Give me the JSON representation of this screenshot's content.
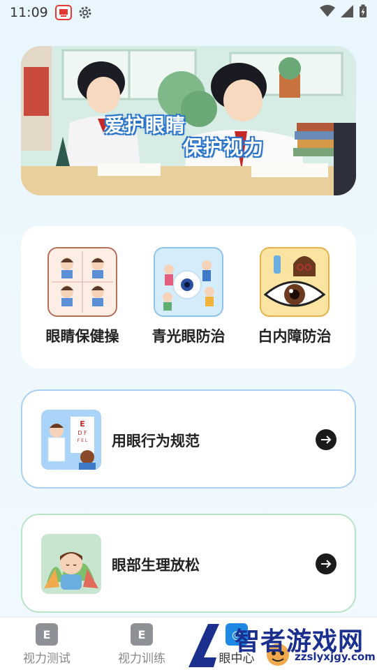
{
  "status_bar": {
    "time": "11:09",
    "icons": [
      "app-notification-icon",
      "settings-gear-icon",
      "wifi-icon",
      "cellular-signal-icon",
      "battery-charging-icon"
    ]
  },
  "banner": {
    "line1": "爱护眼睛",
    "line2": "保护视力"
  },
  "categories": [
    {
      "label": "眼睛保健操",
      "icon": "eye-exercise-thumbnail"
    },
    {
      "label": "青光眼防治",
      "icon": "glaucoma-thumbnail"
    },
    {
      "label": "白内障防治",
      "icon": "cataract-thumbnail"
    }
  ],
  "list": [
    {
      "label": "用眼行为规范",
      "icon": "eye-chart-doctor-thumbnail"
    },
    {
      "label": "眼部生理放松",
      "icon": "relax-child-thumbnail"
    }
  ],
  "nav": [
    {
      "label": "视力测试",
      "icon_text": "E",
      "icon": "vision-test-icon"
    },
    {
      "label": "视力训练",
      "icon_text": "E",
      "icon": "vision-training-icon"
    },
    {
      "label": "眼中心",
      "icon_text": "◎",
      "icon": "eye-center-icon"
    }
  ],
  "watermark": {
    "brand": "智者游戏网",
    "domain": "zzslyxjgy.com"
  },
  "colors": {
    "accent": "#1e88e5",
    "blue_border": "#a9d0f2",
    "green_border": "#b9e3c4"
  }
}
